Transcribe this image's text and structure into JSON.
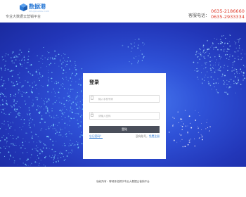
{
  "header": {
    "logo_name": "数据港",
    "logo_sub": "SHUJUGANG.COM",
    "slogan": "专业大数据云营销平台",
    "phone_label": "客服电话：",
    "phones": [
      "0635-2186660",
      "0635-2933334"
    ]
  },
  "login": {
    "title": "登录",
    "username_placeholder": "输入手机号码",
    "password_placeholder": "请输入密码",
    "submit_label": "登陆",
    "forgot_label": "忘记密码？",
    "no_account_label": "没有账号，",
    "register_label": "免费注册"
  },
  "footer": {
    "copyright": "版权所有：聊城传名鹤宇专业大数据云营销平台"
  },
  "colors": {
    "brand": "#2e7bd6",
    "phone": "#e03c2c",
    "button": "#4a4f5b",
    "banner": "#2f52d8"
  },
  "icons": [
    "logo-cube-icon",
    "phone-icon",
    "lock-icon"
  ]
}
